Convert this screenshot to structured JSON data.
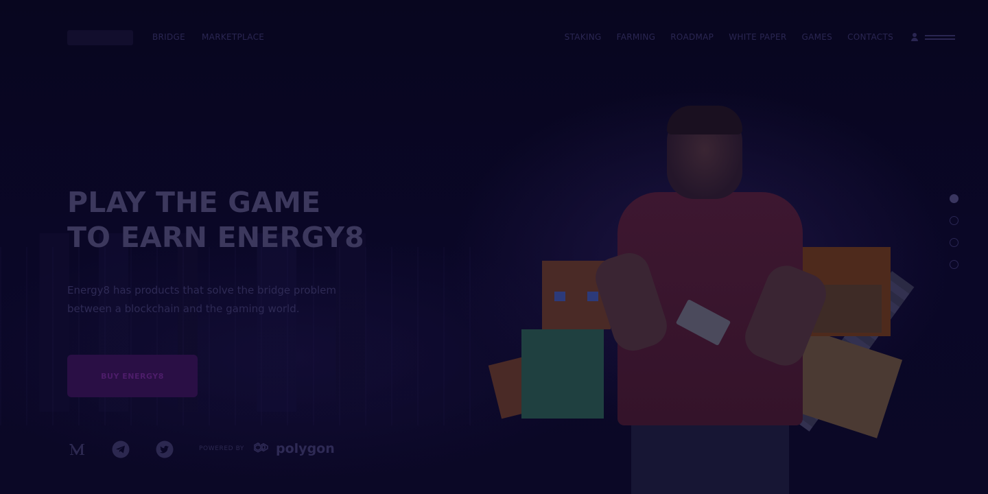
{
  "nav": {
    "left": [
      "BRIDGE",
      "MARKETPLACE"
    ],
    "right": [
      "STAKING",
      "FARMING",
      "ROADMAP",
      "WHITE PAPER",
      "GAMES",
      "CONTACTS"
    ]
  },
  "hero": {
    "title_line1": "PLAY THE GAME",
    "title_line2": "TO EARN ENERGY8",
    "description_line1": "Energy8 has products that solve the bridge problem",
    "description_line2": "between a blockchain and the gaming world.",
    "button_label": "BUY ENERGY8"
  },
  "powered": {
    "label": "POWERED BY",
    "brand": "polygon"
  },
  "socials": [
    "medium-icon",
    "telegram-icon",
    "twitter-icon"
  ],
  "pager": {
    "count": 4,
    "active_index": 0
  },
  "colors": {
    "background": "#070521",
    "button_bg": "#2a0f45",
    "text_dim": "#3c385d"
  }
}
